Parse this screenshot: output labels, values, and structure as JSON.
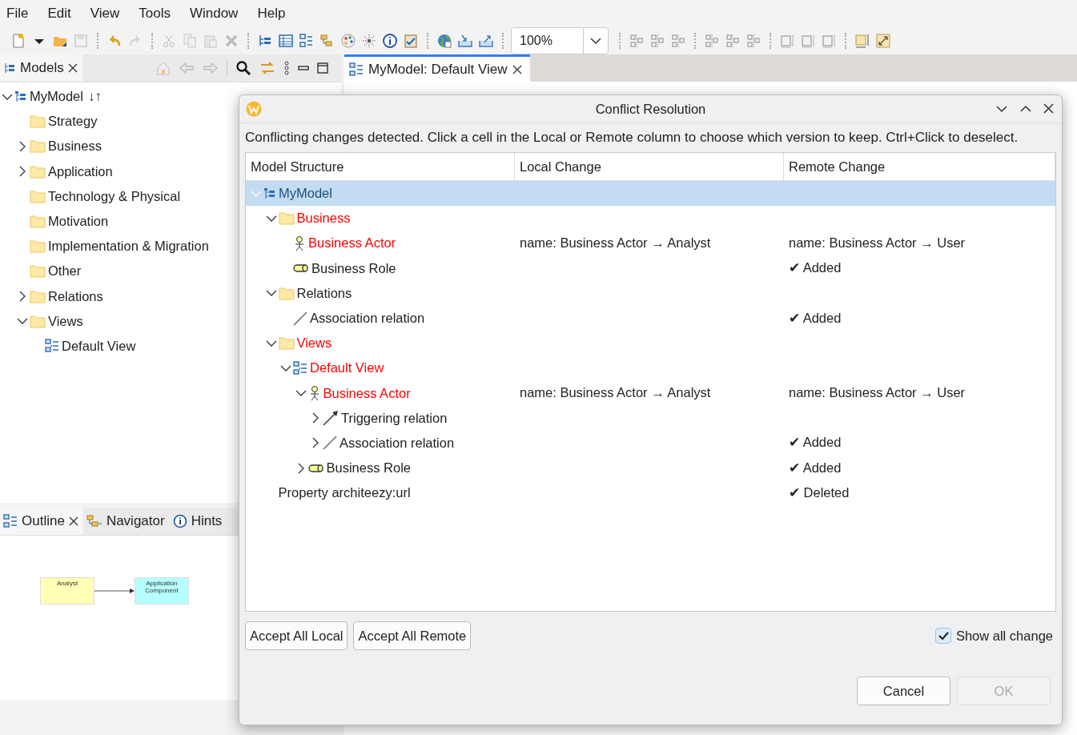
{
  "menu": [
    "File",
    "Edit",
    "View",
    "Tools",
    "Window",
    "Help"
  ],
  "toolbar": {
    "zoom": "100%"
  },
  "models_view": {
    "title": "Models",
    "tree": [
      {
        "label": "MyModel",
        "badge": "↓↑",
        "kind": "model",
        "expanded": true,
        "children": [
          {
            "label": "Strategy",
            "kind": "folder"
          },
          {
            "label": "Business",
            "kind": "folder",
            "expanded": false
          },
          {
            "label": "Application",
            "kind": "folder",
            "expanded": false
          },
          {
            "label": "Technology & Physical",
            "kind": "folder"
          },
          {
            "label": "Motivation",
            "kind": "folder"
          },
          {
            "label": "Implementation & Migration",
            "kind": "folder"
          },
          {
            "label": "Other",
            "kind": "folder"
          },
          {
            "label": "Relations",
            "kind": "folder",
            "expanded": false
          },
          {
            "label": "Views",
            "kind": "folder",
            "expanded": true,
            "children": [
              {
                "label": "Default View",
                "kind": "view"
              }
            ]
          }
        ]
      }
    ]
  },
  "editor_tabs": [
    {
      "label": "MyModel: Default View",
      "selected": true
    }
  ],
  "bottom_tabs": [
    {
      "label": "Outline",
      "kind": "outline",
      "selected": true,
      "closable": true
    },
    {
      "label": "Navigator",
      "kind": "navigator",
      "selected": false,
      "closable": false
    },
    {
      "label": "Hints",
      "kind": "hints",
      "selected": false,
      "closable": false
    }
  ],
  "outline": {
    "nodes": [
      {
        "label": "Analyst",
        "color": "#ffffb5"
      },
      {
        "label": "Application Component",
        "color": "#b5ffff"
      }
    ]
  },
  "dialog": {
    "title": "Conflict Resolution",
    "message": "Conflicting changes detected. Click a cell in the Local or Remote column to choose which version to keep. Ctrl+Click to deselect.",
    "columns": [
      "Model Structure",
      "Local Change",
      "Remote Change"
    ],
    "rows": [
      {
        "label": "MyModel",
        "kind": "model",
        "conflict": false,
        "selected": true,
        "expanded": true,
        "children": [
          {
            "label": "Business",
            "kind": "folder",
            "conflict": true,
            "selected": false,
            "expanded": true,
            "children": [
              {
                "label": "Business Actor",
                "kind": "actor",
                "conflict": true,
                "selected": false,
                "local": "name: Business Actor → Analyst",
                "remote": "name: Business Actor → User"
              },
              {
                "label": "Business Role",
                "kind": "role",
                "conflict": false,
                "selected": false,
                "remote": "✔ Added"
              }
            ]
          },
          {
            "label": "Relations",
            "kind": "folder",
            "conflict": false,
            "selected": false,
            "expanded": true,
            "children": [
              {
                "label": "Association relation",
                "kind": "association",
                "conflict": false,
                "selected": false,
                "remote": "✔ Added"
              }
            ]
          },
          {
            "label": "Views",
            "kind": "folder",
            "conflict": true,
            "selected": false,
            "expanded": true,
            "children": [
              {
                "label": "Default View",
                "kind": "view",
                "conflict": true,
                "selected": false,
                "expanded": true,
                "children": [
                  {
                    "label": "Business Actor",
                    "kind": "actor",
                    "conflict": true,
                    "selected": false,
                    "expanded": true,
                    "local": "name: Business Actor → Analyst",
                    "remote": "name: Business Actor → User",
                    "children": [
                      {
                        "label": "Triggering relation",
                        "kind": "triggering",
                        "conflict": false,
                        "selected": false,
                        "expanded": false
                      },
                      {
                        "label": "Association relation",
                        "kind": "association",
                        "conflict": false,
                        "selected": false,
                        "expanded": false,
                        "remote": "✔ Added"
                      }
                    ]
                  },
                  {
                    "label": "Business Role",
                    "kind": "role",
                    "conflict": false,
                    "selected": false,
                    "expanded": false,
                    "remote": "✔ Added"
                  }
                ]
              }
            ]
          },
          {
            "label": "Property architeezy:url",
            "kind": "property",
            "conflict": false,
            "selected": false,
            "remote": "✔ Deleted"
          }
        ]
      }
    ],
    "buttons": [
      "Accept All Local",
      "Accept All Remote"
    ],
    "show_all": {
      "label": "Show all change",
      "checked": true
    },
    "actions": [
      {
        "label": "Cancel",
        "disabled": false
      },
      {
        "label": "OK",
        "disabled": true
      }
    ]
  }
}
